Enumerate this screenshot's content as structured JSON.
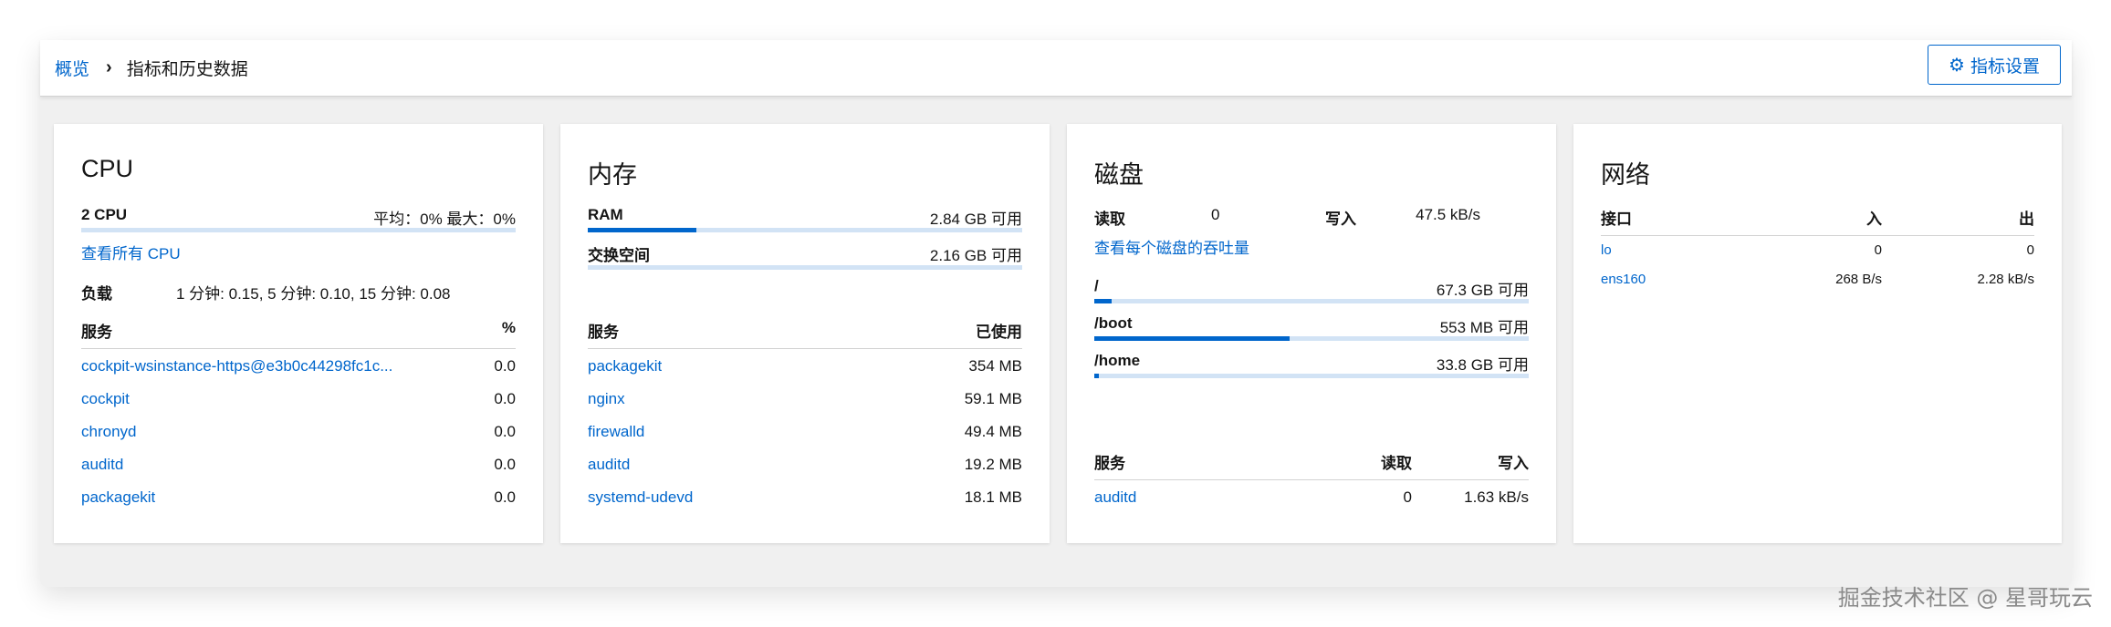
{
  "breadcrumb": {
    "root": "概览",
    "current": "指标和历史数据"
  },
  "settings_button": {
    "label": "指标设置"
  },
  "cpu": {
    "title": "CPU",
    "count_label": "2 CPU",
    "avg_max": "平均：0% 最大：0%",
    "usage_fraction": 0.0,
    "view_all": "查看所有 CPU",
    "load_label": "负载",
    "load_value": "1 分钟: 0.15, 5 分钟: 0.10, 15 分钟: 0.08",
    "col_service": "服务",
    "col_pct": "%",
    "rows": [
      {
        "name": "cockpit-wsinstance-https@e3b0c44298fc1c...",
        "value": "0.0"
      },
      {
        "name": "cockpit",
        "value": "0.0"
      },
      {
        "name": "chronyd",
        "value": "0.0"
      },
      {
        "name": "auditd",
        "value": "0.0"
      },
      {
        "name": "packagekit",
        "value": "0.0"
      }
    ]
  },
  "memory": {
    "title": "内存",
    "ram_label": "RAM",
    "ram_value": "2.84 GB 可用",
    "ram_used_fraction": 0.25,
    "swap_label": "交换空间",
    "swap_value": "2.16 GB 可用",
    "swap_used_fraction": 0.0,
    "col_service": "服务",
    "col_used": "已使用",
    "rows": [
      {
        "name": "packagekit",
        "value": "354 MB"
      },
      {
        "name": "nginx",
        "value": "59.1 MB"
      },
      {
        "name": "firewalld",
        "value": "49.4 MB"
      },
      {
        "name": "auditd",
        "value": "19.2 MB"
      },
      {
        "name": "systemd-udevd",
        "value": "18.1 MB"
      }
    ]
  },
  "disk": {
    "title": "磁盘",
    "read_label": "读取",
    "read_value": "0",
    "write_label": "写入",
    "write_value": "47.5 kB/s",
    "view_all": "查看每个磁盘的吞吐量",
    "mounts": [
      {
        "name": "/",
        "value": "67.3 GB 可用",
        "used_fraction": 0.04
      },
      {
        "name": "/boot",
        "value": "553 MB 可用",
        "used_fraction": 0.45
      },
      {
        "name": "/home",
        "value": "33.8 GB 可用",
        "used_fraction": 0.01
      }
    ],
    "col_service": "服务",
    "col_read": "读取",
    "col_write": "写入",
    "rows": [
      {
        "name": "auditd",
        "read": "0",
        "write": "1.63 kB/s"
      }
    ]
  },
  "network": {
    "title": "网络",
    "col_iface": "接口",
    "col_in": "入",
    "col_out": "出",
    "rows": [
      {
        "name": "lo",
        "in": "0",
        "out": "0"
      },
      {
        "name": "ens160",
        "in": "268 B/s",
        "out": "2.28 kB/s"
      }
    ]
  },
  "watermark": "掘金技术社区 @ 星哥玩云"
}
